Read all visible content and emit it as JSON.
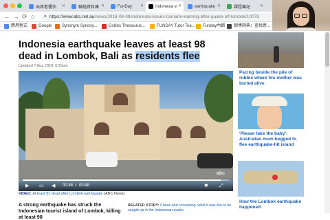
{
  "browser": {
    "tabs": [
      {
        "label": "出席者優佔",
        "color": "#4c8bf5"
      },
      {
        "label": "聯絡資料庫",
        "color": "#4c8bf5"
      },
      {
        "label": "FunDay",
        "color": "#4c8bf5"
      },
      {
        "label": "Indonesia e",
        "color": "#000000"
      },
      {
        "label": "earthquake",
        "color": "#4c8bf5"
      },
      {
        "label": "課程筆記",
        "color": "#34a853"
      }
    ],
    "url_host": "https://www.abc.net.au",
    "url_path": "/news/2018-08-08/indonesia-issues-tsunami-warning-after-quake-off-lombok/10076",
    "bookmarks": [
      {
        "label": "應用程式",
        "icon_color": "#4c8bf5"
      },
      {
        "label": "Google",
        "icon_color": "#ea4335"
      },
      {
        "label": "Synonym Synony...",
        "icon_color": "#e8710a"
      },
      {
        "label": "Collins Thesaurus...",
        "icon_color": "#d93025"
      },
      {
        "label": "FUNDAY Tutor Tea...",
        "icon_color": "#f4b400"
      },
      {
        "label": "Funday內網",
        "icon_color": "#f4b400"
      },
      {
        "label": "朗博詞典：查找意...",
        "icon_color": "#444444"
      }
    ]
  },
  "article": {
    "headline_part1": "Indonesia earthquake leaves at least 98 dead in Lombok, Bali as ",
    "headline_highlight": "residents flee",
    "updated": "Updated 7 Aug 2018, 6:55am",
    "video": {
      "current_time": "00:46",
      "separator": "/",
      "duration": "00:48",
      "progress": 0.96,
      "watermark": "abc"
    },
    "caption_label": "VIDEO:",
    "caption_link": "At least 91 dead after Lombok earthquake",
    "caption_source": " (ABC News)",
    "lead": "A strong earthquake has struck the Indonesian tourist island of Lombok, killing at least 98",
    "related_label": "RELATED STORY:",
    "related_link": "Chaos and screaming: what it was like to be caught up in the Indonesian quake"
  },
  "sidebar": {
    "stories": [
      {
        "title": "Pacing beside the pile of rubble where his mother was buried alive"
      },
      {
        "title": "'Please take the baby': Australian mum begged to flee earthquake-hit island"
      },
      {
        "title": "How the Lombok earthquake happened"
      }
    ]
  },
  "icons": {
    "back": "←",
    "forward": "→",
    "reload": "⟳",
    "home": "⌂",
    "play": "▶",
    "captions": "▭",
    "volume": "◀",
    "settings": "✱",
    "fullscreen": "⤢",
    "lock": "🔒",
    "close": "✕"
  }
}
